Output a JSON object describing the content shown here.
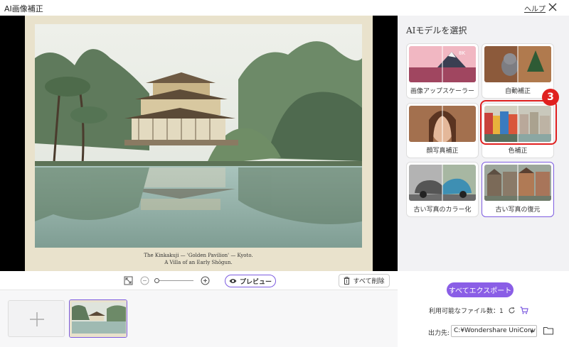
{
  "window": {
    "title": "AI画像補正",
    "help": "ヘルプ"
  },
  "photo": {
    "caption_line1": "The Kinkakuji — 'Golden Pavilion' — Kyoto.",
    "caption_line2": "A Villa of an Early Shōgun."
  },
  "models": {
    "heading": "AIモデルを選択",
    "items": [
      {
        "label": "画像アップスケーラー"
      },
      {
        "label": "自動補正"
      },
      {
        "label": "顔写真補正"
      },
      {
        "label": "色補正"
      },
      {
        "label": "古い写真のカラー化"
      },
      {
        "label": "古い写真の復元"
      }
    ],
    "step_badge": "3",
    "accent_color": "#7d5ce0",
    "highlight_color": "#e0201f"
  },
  "toolbar": {
    "preview_label": "プレビュー",
    "delete_all_label": "すべて削除",
    "zoom_level": 0
  },
  "export": {
    "export_all_label": "すべてエクスポート",
    "available_files_label": "利用可能なファイル数：1",
    "output_label": "出力先:",
    "output_path": "C:¥Wondershare UniConv"
  }
}
